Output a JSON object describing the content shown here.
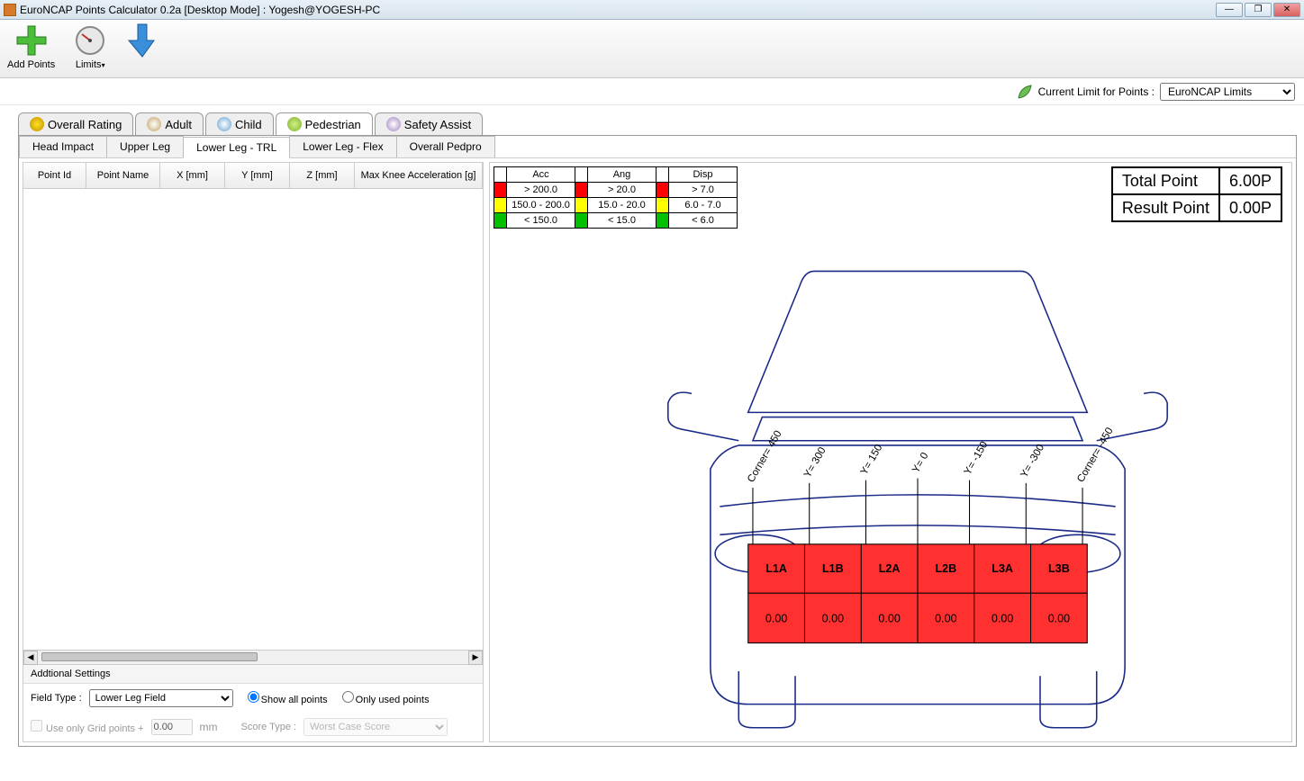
{
  "title": "EuroNCAP Points Calculator 0.2a [Desktop Mode] : Yogesh@YOGESH-PC",
  "toolbar": {
    "add_points": "Add Points",
    "limits": "Limits"
  },
  "limit_bar": {
    "label": "Current Limit for Points :",
    "selected": "EuroNCAP Limits"
  },
  "main_tabs": [
    "Overall Rating",
    "Adult",
    "Child",
    "Pedestrian",
    "Safety Assist"
  ],
  "main_tab_active_index": 3,
  "sub_tabs": [
    "Head Impact",
    "Upper Leg",
    "Lower Leg - TRL",
    "Lower Leg - Flex",
    "Overall Pedpro"
  ],
  "sub_tab_active_index": 2,
  "grid": {
    "columns": [
      "Point Id",
      "Point Name",
      "X [mm]",
      "Y [mm]",
      "Z [mm]",
      "Max Knee Acceleration [g]"
    ]
  },
  "settings": {
    "title": "Addtional Settings",
    "field_type_label": "Field Type  :",
    "field_type_value": "Lower Leg Field",
    "show_all": "Show all points",
    "only_used": "Only used points",
    "grid_points": "Use only Grid points +",
    "grid_value": "0.00",
    "grid_unit": "mm",
    "score_type_label": "Score Type :",
    "score_type_value": "Worst Case Score"
  },
  "legend": {
    "headers": [
      "Acc",
      "Ang",
      "Disp"
    ],
    "rows": [
      {
        "color": "red",
        "acc": "> 200.0",
        "ang": "> 20.0",
        "disp": "> 7.0"
      },
      {
        "color": "yellow",
        "acc": "150.0 - 200.0",
        "ang": "15.0 - 20.0",
        "disp": "6.0 - 7.0"
      },
      {
        "color": "green",
        "acc": "< 150.0",
        "ang": "< 15.0",
        "disp": "< 6.0"
      }
    ]
  },
  "score": {
    "total_label": "Total Point",
    "total_value": "6.00P",
    "result_label": "Result Point",
    "result_value": "0.00P"
  },
  "zones": [
    {
      "name": "L1A",
      "value": "0.00"
    },
    {
      "name": "L1B",
      "value": "0.00"
    },
    {
      "name": "L2A",
      "value": "0.00"
    },
    {
      "name": "L2B",
      "value": "0.00"
    },
    {
      "name": "L3A",
      "value": "0.00"
    },
    {
      "name": "L3B",
      "value": "0.00"
    }
  ],
  "grid_labels": [
    "Corner= 450",
    "Y= 300",
    "Y= 150",
    "Y= 0",
    "Y= -150",
    "Y= -300",
    "Corner= -450"
  ]
}
